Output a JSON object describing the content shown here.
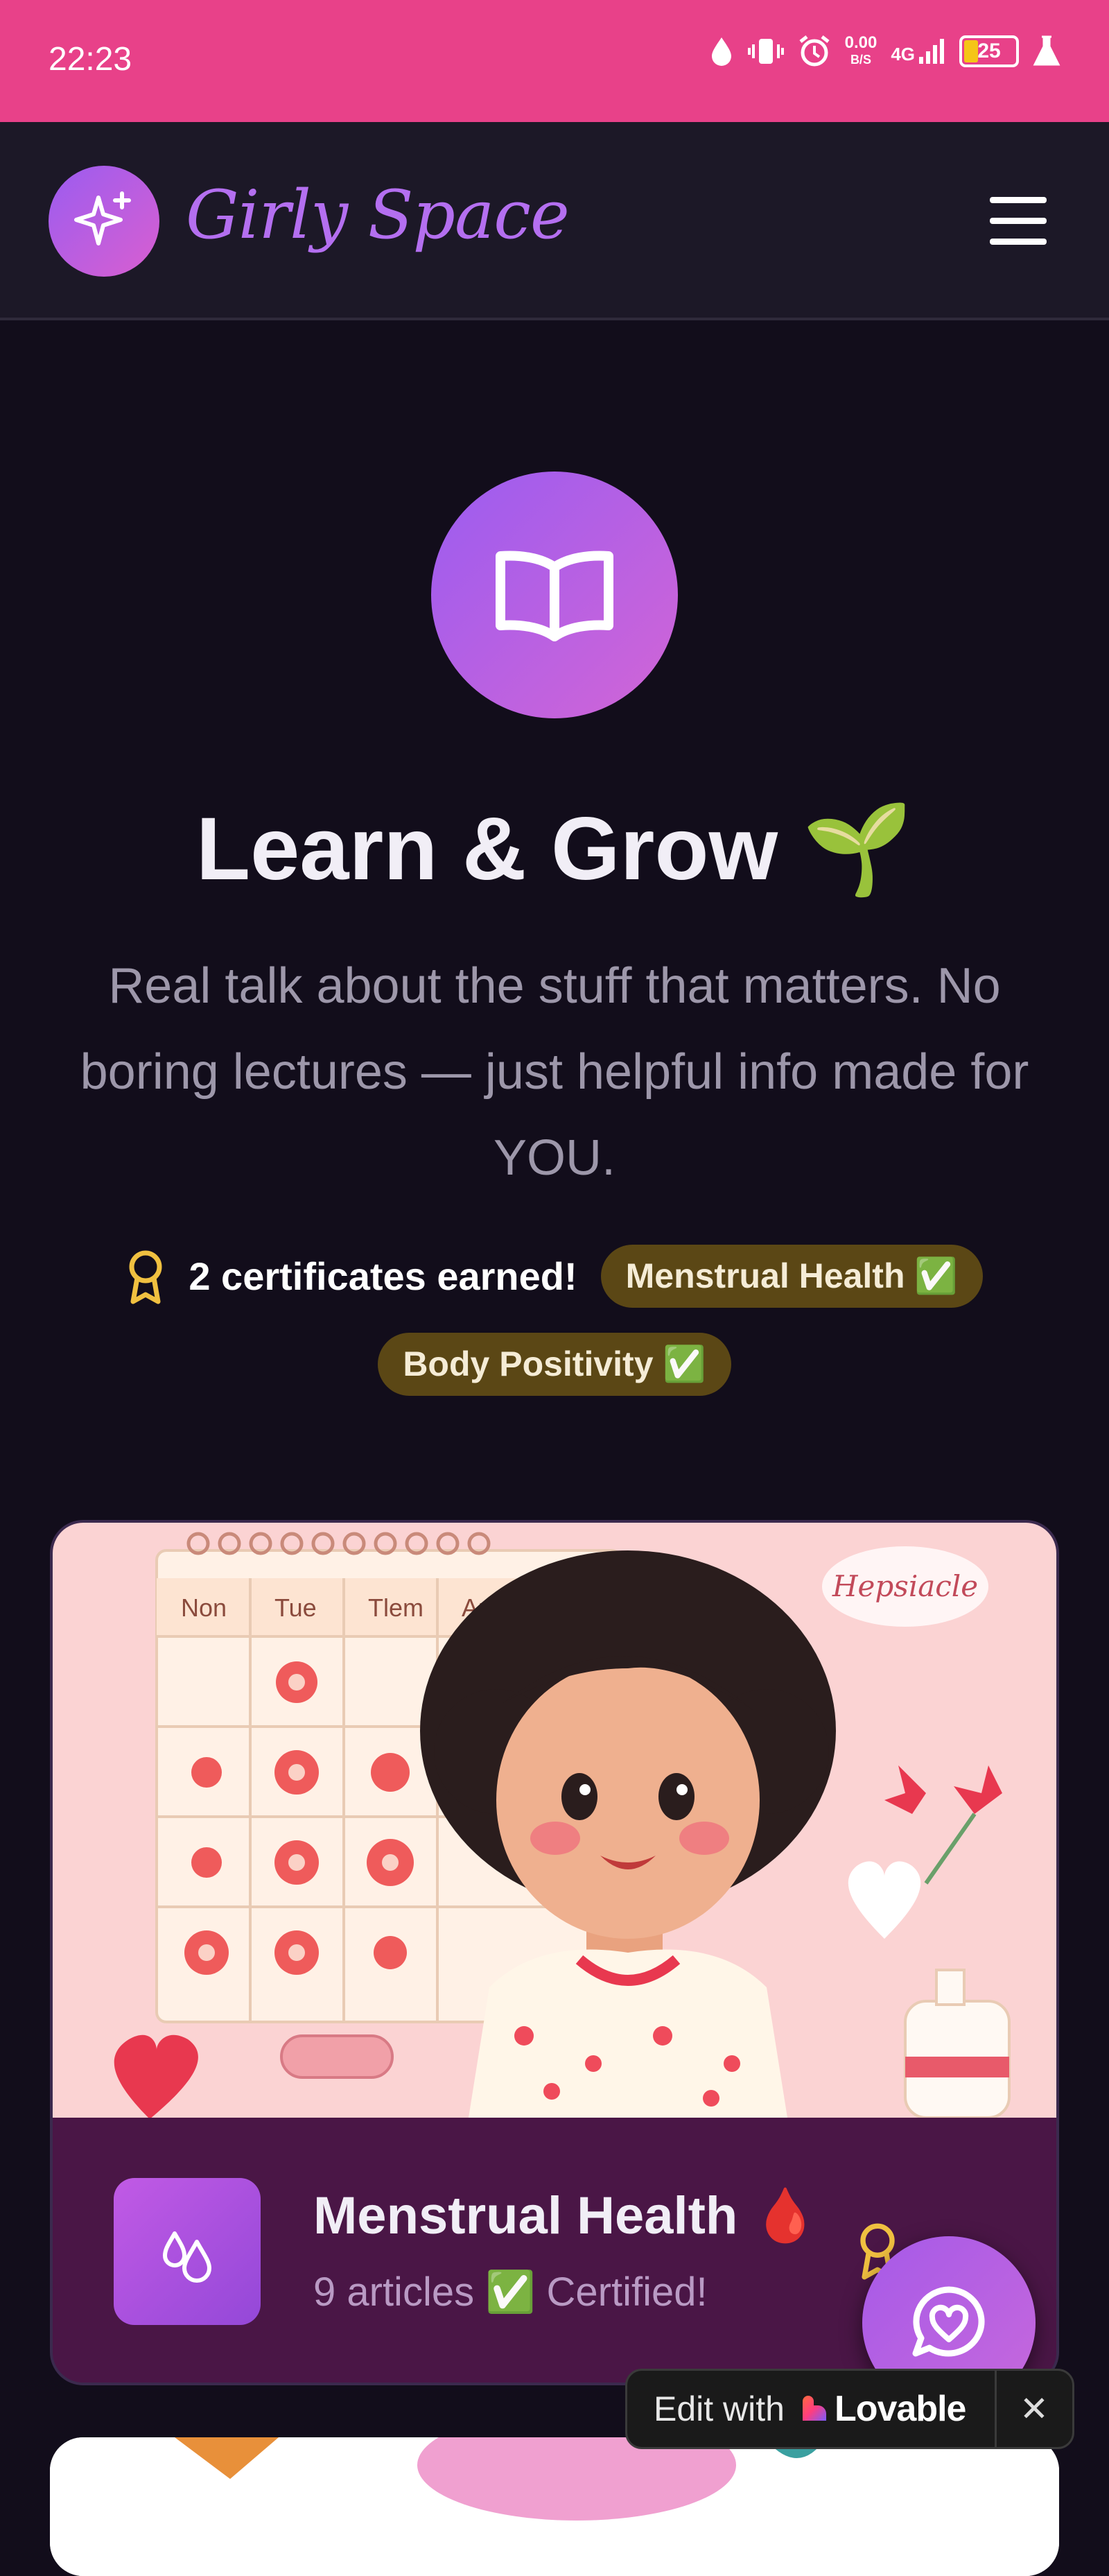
{
  "status_bar": {
    "time": "22:23",
    "net_speed": "0.00",
    "net_unit": "B/S",
    "signal": "4G",
    "battery": "25"
  },
  "header": {
    "brand": "Girly Space"
  },
  "hero": {
    "title": "Learn & Grow 🌱",
    "subtitle": "Real talk about the stuff that matters. No boring lectures — just helpful info made for YOU.",
    "certificates_label": "2 certificates earned!",
    "certificates": [
      "Menstrual Health ✅",
      "Body Positivity ✅"
    ]
  },
  "topics": [
    {
      "title": "Menstrual Health 🩸",
      "meta": "9 articles ✅ Certified!",
      "illustration": {
        "days": [
          "Non",
          "Tue",
          "Tlem",
          "Ar"
        ],
        "sticker": "Hepsiacle"
      }
    }
  ],
  "lovable_badge": {
    "edit": "Edit with",
    "brand": "Lovable",
    "close": "✕"
  },
  "colors": {
    "status_bar": "#e84189",
    "background": "#120d1b",
    "header": "#1c1827",
    "accent": "#9b5cf0",
    "card_footer": "#4a1646",
    "pill": "#5b4715"
  },
  "icons": {
    "brand": "sparkles-icon",
    "menu": "hamburger-menu-icon",
    "hero": "book-open-icon",
    "certificates": "award-icon",
    "topic": "droplets-icon",
    "fab": "chat-heart-icon"
  }
}
